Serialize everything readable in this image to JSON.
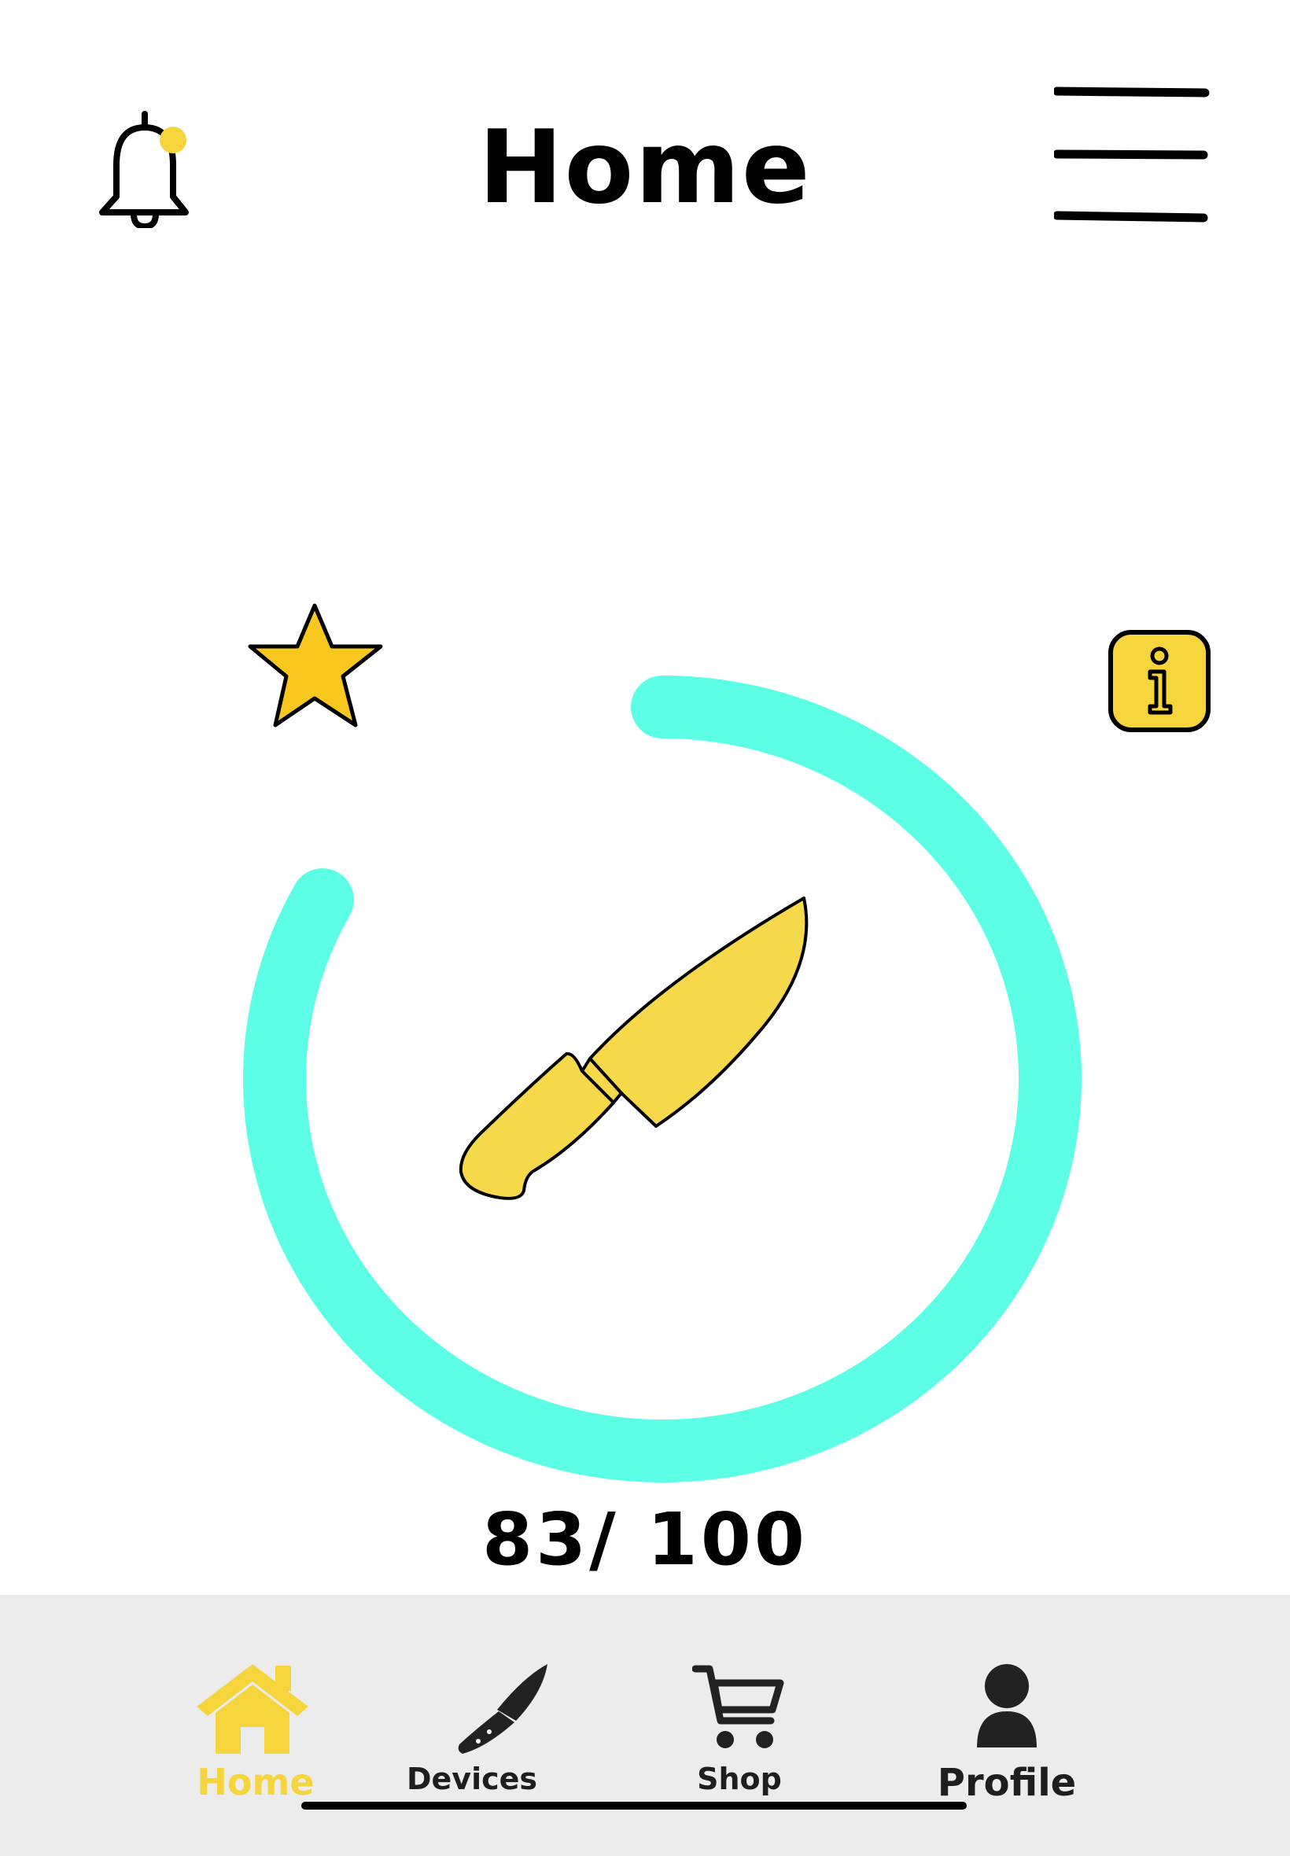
{
  "header": {
    "title": "Home",
    "notification_icon": "bell-icon",
    "notification_badge_color": "#f5d53b",
    "menu_icon": "hamburger-menu-icon"
  },
  "main": {
    "favorite_icon": "star-icon",
    "info_icon": "info-icon",
    "device_icon": "knife-icon",
    "progress": {
      "value": 83,
      "max": 100,
      "color": "#5cffe6"
    },
    "score_text": "83/ 100"
  },
  "tabbar": {
    "active_color": "#f5d53b",
    "tabs": [
      {
        "label": "Home",
        "icon": "house-icon",
        "active": true
      },
      {
        "label": "Devices",
        "icon": "knife-icon",
        "active": false
      },
      {
        "label": "Shop",
        "icon": "cart-icon",
        "active": false
      },
      {
        "label": "Profile",
        "icon": "person-icon",
        "active": false
      }
    ]
  }
}
